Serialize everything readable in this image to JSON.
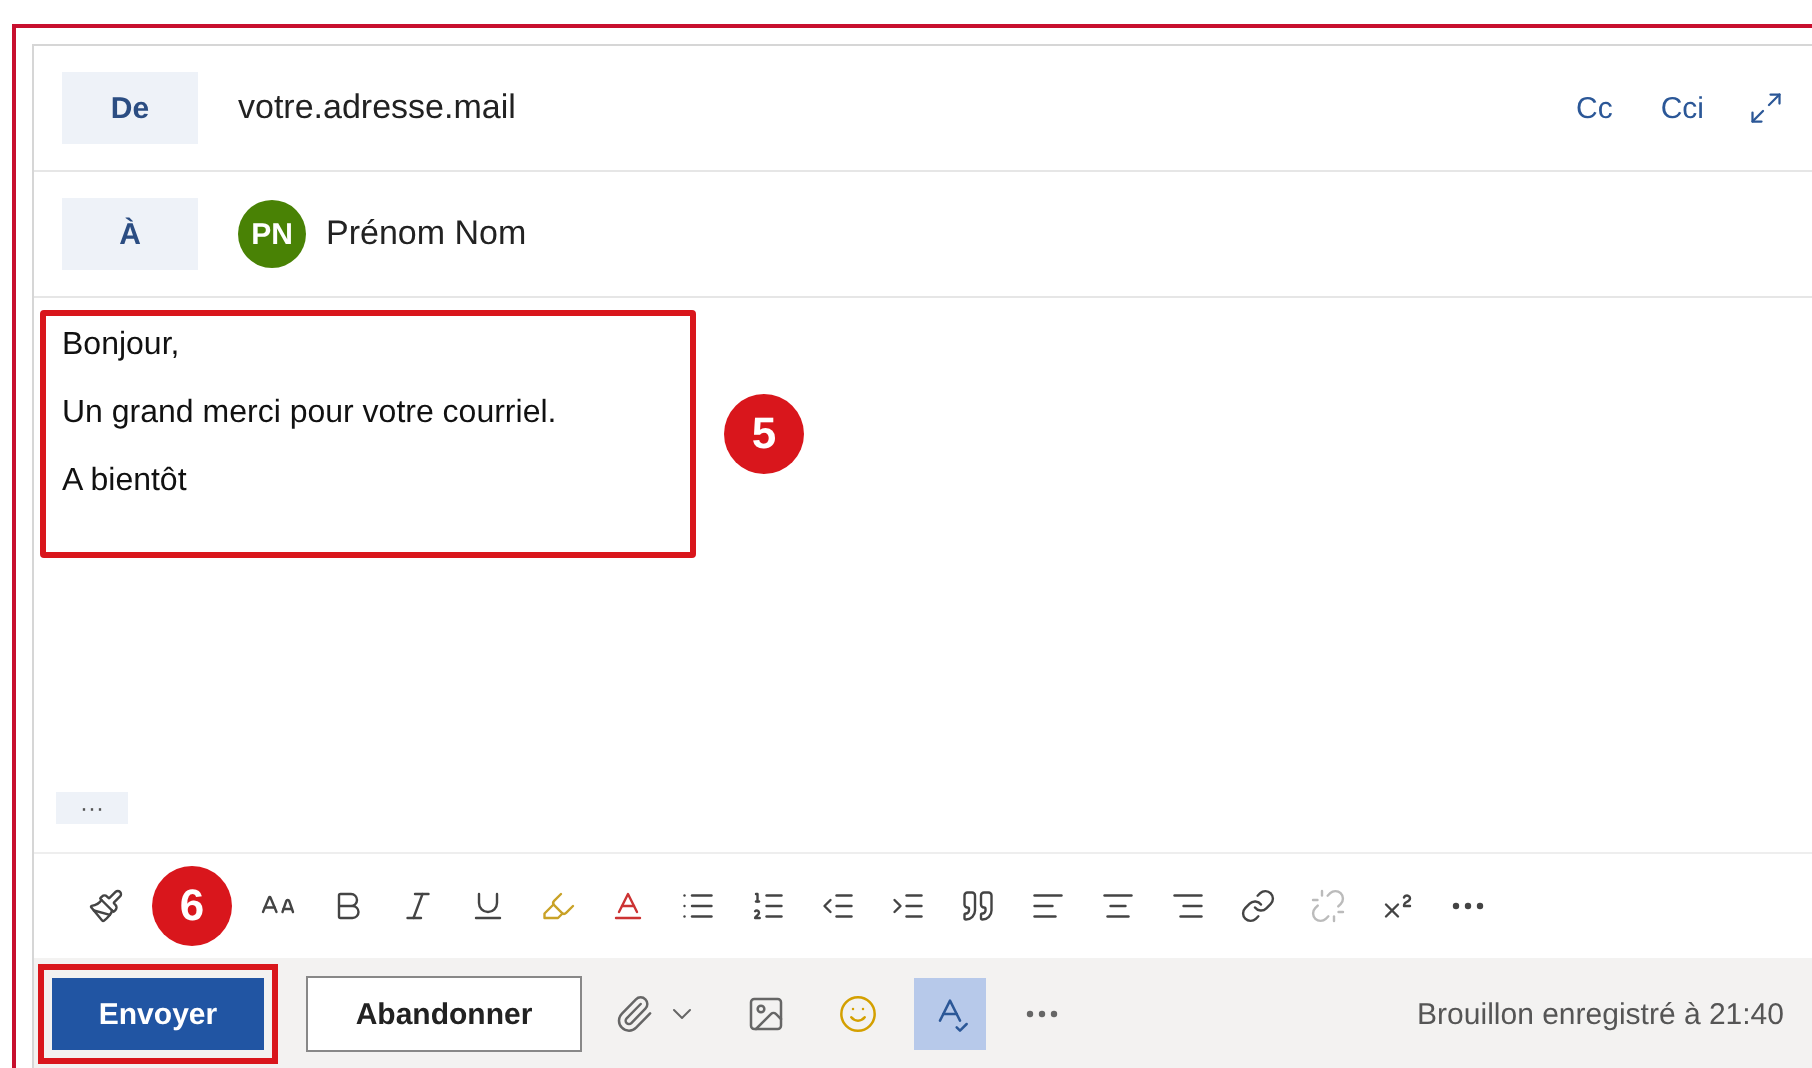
{
  "from": {
    "label": "De",
    "value": "votre.adresse.mail",
    "cc": "Cc",
    "bcc": "Cci"
  },
  "to": {
    "label": "À",
    "recipients": [
      {
        "initials": "PN",
        "name": "Prénom Nom",
        "color": "#498205"
      }
    ]
  },
  "body": {
    "paragraphs": [
      "Bonjour,",
      "Un grand merci pour votre courriel.",
      "A bientôt"
    ],
    "more": "···",
    "step_badge": "5"
  },
  "toolbar": [
    {
      "kind": "painter",
      "disabled": false
    },
    {
      "kind": "fontsize",
      "disabled": false
    },
    {
      "kind": "bold",
      "disabled": false
    },
    {
      "kind": "italic",
      "disabled": false
    },
    {
      "kind": "underline",
      "disabled": false
    },
    {
      "kind": "highlight",
      "disabled": false
    },
    {
      "kind": "fontcolor",
      "disabled": false
    },
    {
      "kind": "bullets",
      "disabled": false
    },
    {
      "kind": "numbering",
      "disabled": false
    },
    {
      "kind": "outdent",
      "disabled": false
    },
    {
      "kind": "indent",
      "disabled": false
    },
    {
      "kind": "quote",
      "disabled": false
    },
    {
      "kind": "alignleft",
      "disabled": false
    },
    {
      "kind": "aligncenter",
      "disabled": false
    },
    {
      "kind": "alignright",
      "disabled": false
    },
    {
      "kind": "link",
      "disabled": false
    },
    {
      "kind": "unlink",
      "disabled": true
    },
    {
      "kind": "superscript",
      "disabled": false
    },
    {
      "kind": "more",
      "disabled": false
    }
  ],
  "actions": {
    "step_badge": "6",
    "send": "Envoyer",
    "discard": "Abandonner",
    "tools": [
      {
        "kind": "attach",
        "selected": false
      },
      {
        "kind": "image",
        "selected": false
      },
      {
        "kind": "emoji",
        "selected": false
      },
      {
        "kind": "editor",
        "selected": true
      },
      {
        "kind": "more",
        "selected": false
      }
    ],
    "status": "Brouillon enregistré à 21:40"
  }
}
